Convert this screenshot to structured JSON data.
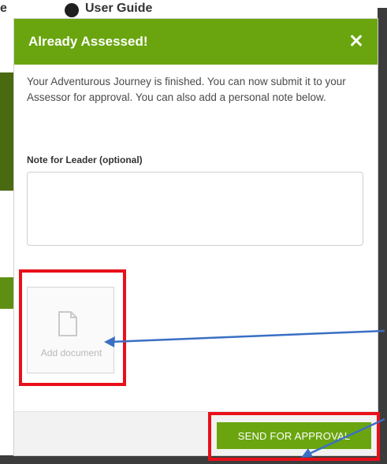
{
  "background": {
    "fragment_left": "e",
    "fragment_title": "User Guide"
  },
  "modal": {
    "title": "Already Assessed!",
    "body_text": "Your Adventurous Journey is finished. You can now submit it to your Assessor for approval. You can also add a personal note below.",
    "note_label": "Note for Leader (optional)",
    "note_value": "",
    "add_document_label": "Add document",
    "send_button_label": "SEND FOR APPROVAL"
  },
  "icons": {
    "close": "close-icon",
    "document": "document-icon",
    "info": "info-icon"
  },
  "colors": {
    "brand_green": "#6aa50f",
    "annotation_red": "#e8101a",
    "annotation_arrow_blue": "#3a6fc4"
  }
}
